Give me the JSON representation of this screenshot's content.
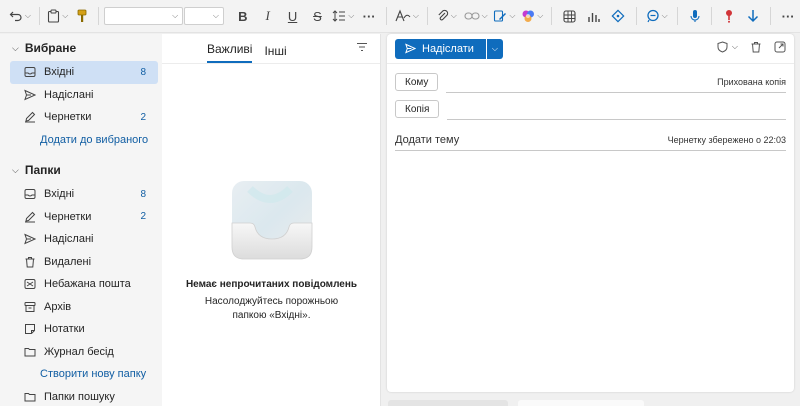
{
  "toolbar": {
    "undo_icon": "undo-icon",
    "clipboard_icon": "clipboard-icon",
    "format_painter_icon": "format-painter-icon",
    "font_name": "",
    "font_size": "",
    "bold": "B",
    "italic": "I",
    "underline": "U",
    "strikethrough": "S",
    "more": "···"
  },
  "sidebar": {
    "favorites_title": "Вибране",
    "favorites": [
      {
        "label": "Вхідні",
        "count": "8"
      },
      {
        "label": "Надіслані",
        "count": ""
      },
      {
        "label": "Чернетки",
        "count": "2"
      }
    ],
    "add_favorite": "Додати до вибраного",
    "folders_title": "Папки",
    "folders": [
      {
        "label": "Вхідні",
        "count": "8"
      },
      {
        "label": "Чернетки",
        "count": "2"
      },
      {
        "label": "Надіслані",
        "count": ""
      },
      {
        "label": "Видалені",
        "count": ""
      },
      {
        "label": "Небажана пошта",
        "count": ""
      },
      {
        "label": "Архів",
        "count": ""
      },
      {
        "label": "Нотатки",
        "count": ""
      },
      {
        "label": "Журнал бесід",
        "count": ""
      }
    ],
    "create_folder": "Створити нову папку",
    "search_folders": "Папки пошуку"
  },
  "message_list": {
    "tabs": [
      "Важливі",
      "Інші"
    ],
    "empty_title": "Немає непрочитаних повідомлень",
    "empty_subtitle": "Насолоджуйтесь порожньою папкою «Вхідні»."
  },
  "compose": {
    "send_label": "Надіслати",
    "to_button": "Кому",
    "bcc_label": "Прихована копія",
    "cc_button": "Копія",
    "subject_placeholder": "Додати тему",
    "draft_status": "Чернетку збережено о 22:03"
  },
  "colors": {
    "accent": "#0f6cbd",
    "selected_bg": "#cfe0f5",
    "link": "#115ea3"
  }
}
